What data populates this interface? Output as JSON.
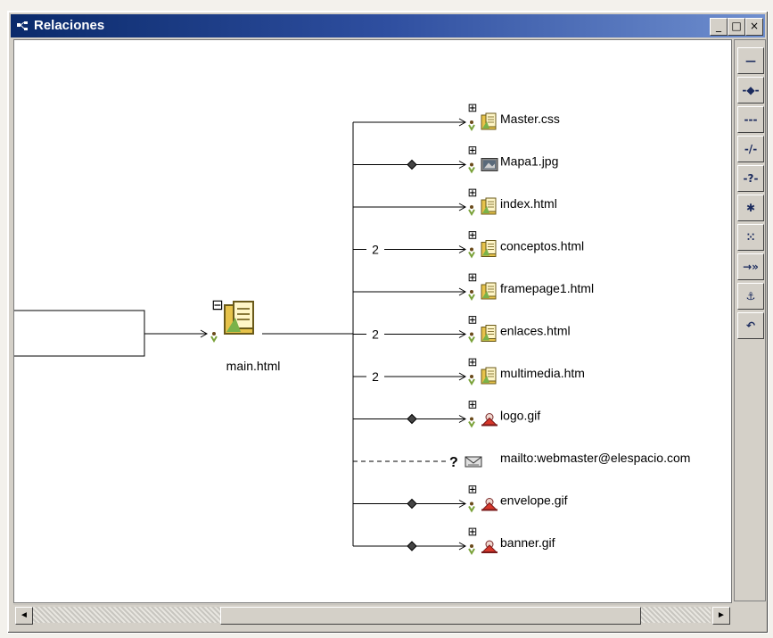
{
  "window": {
    "title": "Relaciones",
    "buttons": {
      "minimize": "_",
      "maximize": "□",
      "close": "×"
    }
  },
  "graph": {
    "root": {
      "label": "main.html",
      "collapse_glyph": "⊟"
    },
    "children": [
      {
        "label": "Master.css",
        "connector": "plain",
        "icon": "document-icon",
        "expand_glyph": "⊞"
      },
      {
        "label": "Mapa1.jpg",
        "connector": "diamond",
        "icon": "image-icon",
        "expand_glyph": "⊞"
      },
      {
        "label": "index.html",
        "connector": "plain",
        "icon": "document-icon",
        "expand_glyph": "⊞"
      },
      {
        "label": "conceptos.html",
        "connector": "count",
        "count": "2",
        "icon": "document-icon",
        "expand_glyph": "⊞"
      },
      {
        "label": "framepage1.html",
        "connector": "plain",
        "icon": "document-icon",
        "expand_glyph": "⊞"
      },
      {
        "label": "enlaces.html",
        "connector": "count",
        "count": "2",
        "icon": "document-icon",
        "expand_glyph": "⊞"
      },
      {
        "label": "multimedia.htm",
        "connector": "count",
        "count": "2",
        "icon": "document-icon",
        "expand_glyph": "⊞"
      },
      {
        "label": "logo.gif",
        "connector": "diamond",
        "icon": "gif-image-icon",
        "expand_glyph": "⊞"
      },
      {
        "label": "mailto:webmaster@elespacio.com",
        "connector": "unknown",
        "unknown_mark": "?",
        "icon": "mail-icon",
        "expand_glyph": ""
      },
      {
        "label": "envelope.gif",
        "connector": "diamond",
        "icon": "gif-image-icon",
        "expand_glyph": "⊞"
      },
      {
        "label": "banner.gif",
        "connector": "diamond",
        "icon": "gif-image-icon",
        "expand_glyph": "⊞"
      }
    ]
  },
  "toolbox": [
    {
      "name": "link-tool-icon",
      "glyph": "—"
    },
    {
      "name": "link-diamond-tool-icon",
      "glyph": "-◆-"
    },
    {
      "name": "dashed-link-tool-icon",
      "glyph": "---"
    },
    {
      "name": "broken-link-tool-icon",
      "glyph": "-/-"
    },
    {
      "name": "unknown-link-tool-icon",
      "glyph": "-?-"
    },
    {
      "name": "star-tool-icon",
      "glyph": "✱"
    },
    {
      "name": "expand-tool-icon",
      "glyph": "⁙"
    },
    {
      "name": "forward-tool-icon",
      "glyph": "→»"
    },
    {
      "name": "anchor-tool-icon",
      "glyph": "⚓"
    },
    {
      "name": "undo-tool-icon",
      "glyph": "↶"
    }
  ],
  "scrollbar": {
    "left_arrow": "◄",
    "right_arrow": "►"
  },
  "colors": {
    "title_start": "#0a2a6b",
    "title_end": "#6f8fcf",
    "line": "#000000",
    "doc_icon": "#e6c24a",
    "gif_icon": "#d6372a"
  }
}
